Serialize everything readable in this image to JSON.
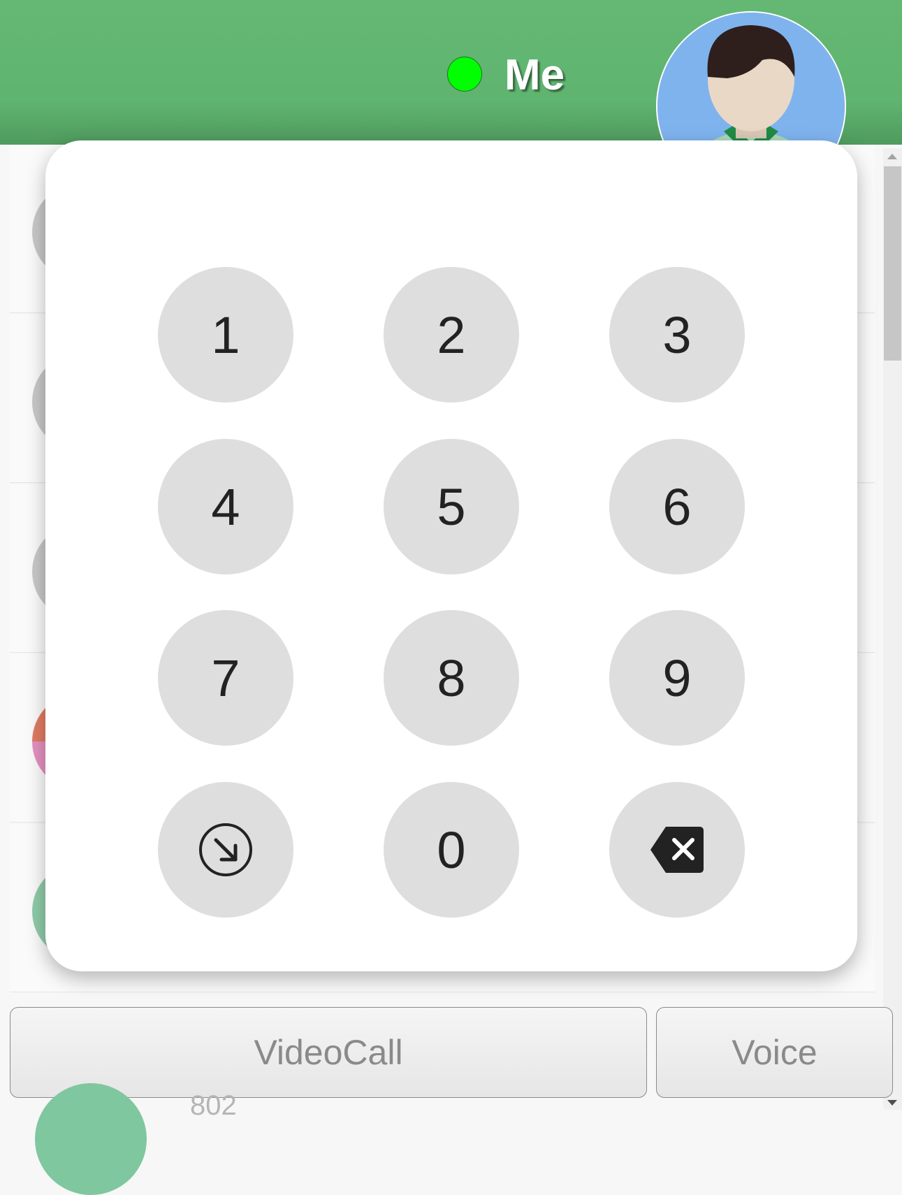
{
  "header": {
    "title": "Me",
    "status_color": "#00ff00",
    "background_color": "#60b572"
  },
  "dialpad": {
    "keys": [
      "1",
      "2",
      "3",
      "4",
      "5",
      "6",
      "7",
      "8",
      "9",
      "",
      "0",
      ""
    ],
    "left_icon": "arrow-down-right-circle-icon",
    "right_icon": "backspace-icon"
  },
  "actions": {
    "video_label": "VideoCall",
    "voice_label": "Voice"
  },
  "contacts": {
    "partial_extension": "802"
  }
}
